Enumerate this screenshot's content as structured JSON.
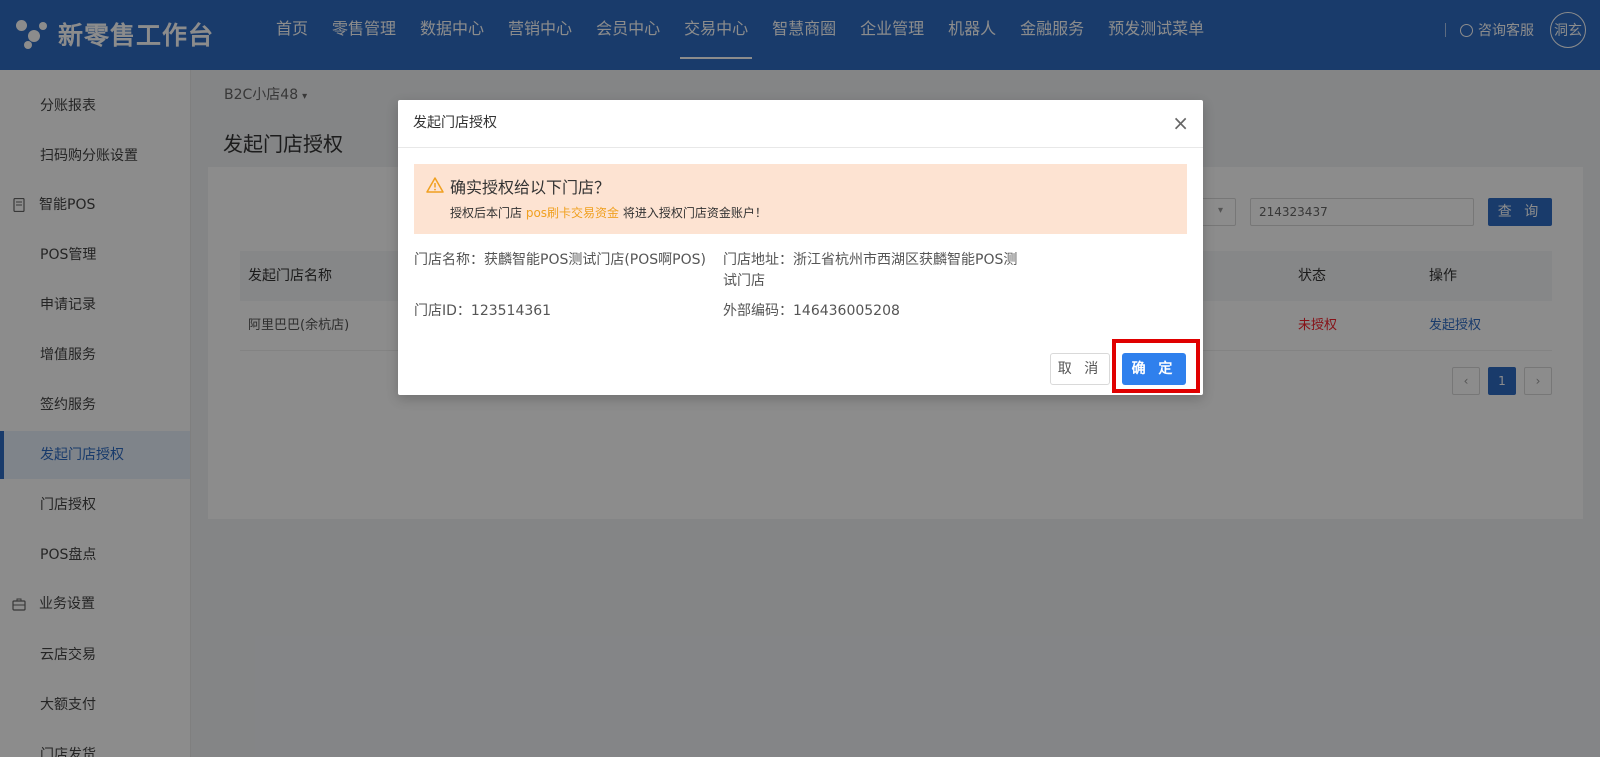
{
  "brand": {
    "title": "新零售工作台",
    "logo_icon": "brand-logo-icon"
  },
  "nav": {
    "items": [
      "首页",
      "零售管理",
      "数据中心",
      "营销中心",
      "会员中心",
      "交易中心",
      "智慧商圈",
      "企业管理",
      "机器人",
      "金融服务",
      "预发测试菜单"
    ],
    "active": "交易中心"
  },
  "top_right": {
    "service_label": "咨询客服",
    "avatar_text": "洞玄"
  },
  "sidebar": {
    "items": [
      {
        "label": "分账报表"
      },
      {
        "label": "扫码购分账设置"
      },
      {
        "label": "智能POS",
        "group": true,
        "icon": "pos-device-icon"
      },
      {
        "label": "POS管理"
      },
      {
        "label": "申请记录"
      },
      {
        "label": "增值服务"
      },
      {
        "label": "签约服务"
      },
      {
        "label": "发起门店授权",
        "active": true
      },
      {
        "label": "门店授权"
      },
      {
        "label": "POS盘点"
      },
      {
        "label": "业务设置",
        "group": true,
        "icon": "briefcase-icon"
      },
      {
        "label": "云店交易"
      },
      {
        "label": "大额支付"
      },
      {
        "label": "门店发货"
      }
    ]
  },
  "breadcrumb": {
    "store": "B2C小店48"
  },
  "page": {
    "title": "发起门店授权"
  },
  "filters": {
    "search_value": "214323437",
    "query_label": "查 询"
  },
  "table": {
    "columns": [
      "发起门店名称",
      "状态",
      "操作"
    ],
    "rows": [
      {
        "name": "阿里巴巴(余杭店)",
        "status": "未授权",
        "action": "发起授权"
      }
    ]
  },
  "pagination": {
    "current": "1"
  },
  "modal": {
    "title": "发起门店授权",
    "alert_title": "确实授权给以下门店？",
    "alert_desc_prefix": "授权后本门店",
    "alert_desc_highlight": "pos刷卡交易资金",
    "alert_desc_suffix": "将进入授权门店资金账户！",
    "store_name": "门店名称：获麟智能POS测试门店(POS啊POS)",
    "store_address_line1": "门店地址：浙江省杭州市西湖区获麟智能POS测",
    "store_address_line2": "试门店",
    "store_id": "门店ID：123514361",
    "external_code": "外部编码：146436005208",
    "cancel_label": "取 消",
    "ok_label": "确 定"
  },
  "colors": {
    "primary": "#2f6cc4",
    "alert_bg": "#fde3d2",
    "highlight": "#f0a020",
    "danger": "#f5222d",
    "annotation": "#e00000"
  }
}
